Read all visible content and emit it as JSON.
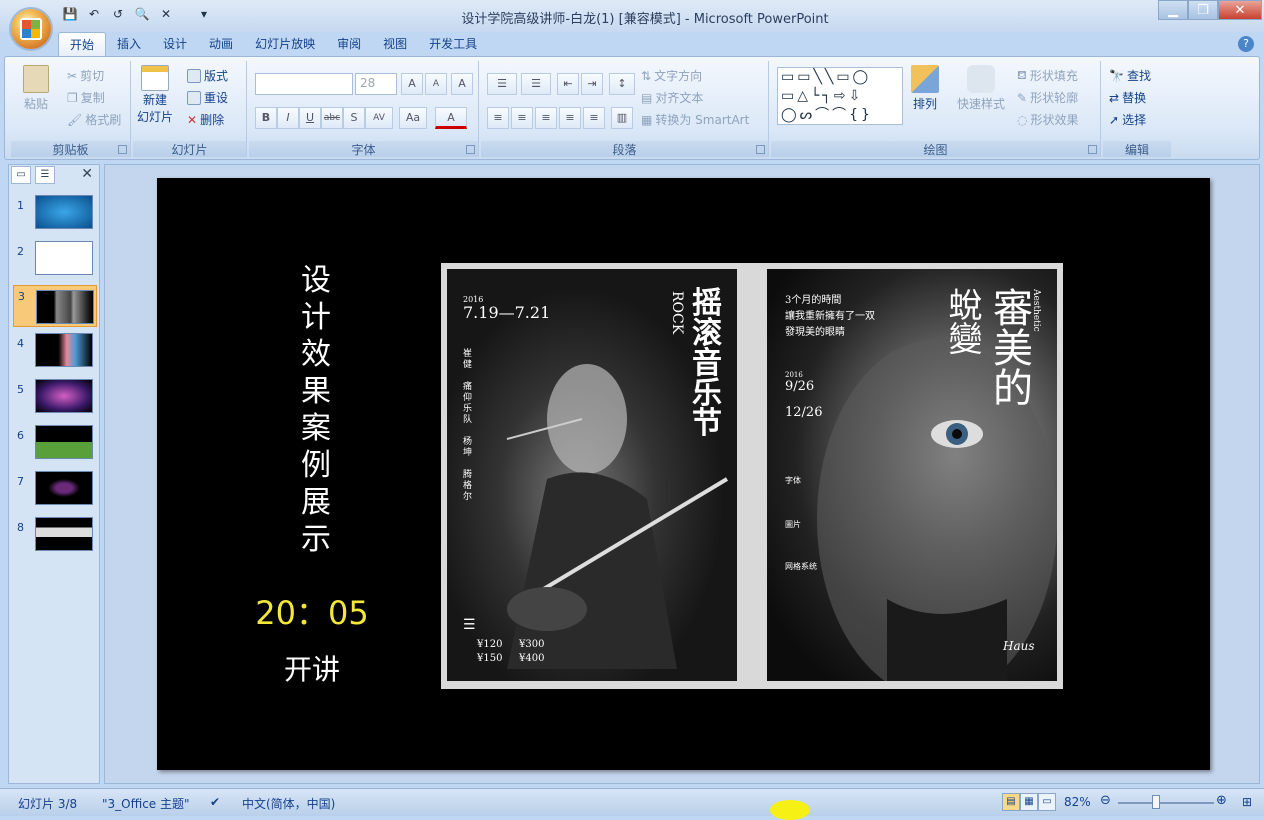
{
  "window": {
    "title": "设计学院高级讲师-白龙(1) [兼容模式] - Microsoft PowerPoint",
    "minimize": "▁",
    "restore": "❐",
    "close": "✕"
  },
  "qat": {
    "save": "💾",
    "undo": "↶",
    "redo": "↺",
    "preview": "🔍",
    "extra": "✕",
    "more": "▾"
  },
  "tabs": [
    "开始",
    "插入",
    "设计",
    "动画",
    "幻灯片放映",
    "审阅",
    "视图",
    "开发工具"
  ],
  "help": "?",
  "ribbon": {
    "clipboard": {
      "label": "剪贴板",
      "paste": "粘贴",
      "cut": "剪切",
      "copy": "复制",
      "format_painter": "格式刷"
    },
    "slides": {
      "label": "幻灯片",
      "new_slide_1": "新建",
      "new_slide_2": "幻灯片",
      "layout": "版式",
      "reset": "重设",
      "delete": "删除"
    },
    "font": {
      "label": "字体",
      "font_size": "28",
      "grow": "A",
      "shrink": "A",
      "clear": "A",
      "bold": "B",
      "italic": "I",
      "underline": "U",
      "strike": "abc",
      "shadow": "S",
      "spacing": "AV",
      "case": "Aa",
      "color": "A"
    },
    "paragraph": {
      "label": "段落",
      "text_direction": "文字方向",
      "align_text": "对齐文本",
      "smartart": "转换为 SmartArt"
    },
    "drawing": {
      "label": "绘图",
      "arrange": "排列",
      "quick_styles": "快速样式",
      "shape_fill": "形状填充",
      "shape_outline": "形状轮廓",
      "shape_effects": "形状效果"
    },
    "editing": {
      "label": "编辑",
      "find": "查找",
      "replace": "替换",
      "select": "选择"
    }
  },
  "slide_panel": {
    "thumbs": [
      "1",
      "2",
      "3",
      "4",
      "5",
      "6",
      "7",
      "8"
    ],
    "selected": 3,
    "close": "✕"
  },
  "slide": {
    "title_chars": [
      "设",
      "计",
      "效",
      "果",
      "案",
      "例",
      "展",
      "示"
    ],
    "timer": "20：05",
    "subtitle": "开讲"
  },
  "poster1": {
    "date_year": "2016",
    "date": "7.19—7.21",
    "rock": "ROCK",
    "title_chars": [
      "摇",
      "滚",
      "音",
      "乐",
      "节"
    ],
    "bands": [
      "崔",
      "健",
      "痛",
      "仰",
      "乐",
      "队",
      "杨",
      "坤",
      "腾",
      "格",
      "尔"
    ],
    "price1": "¥120",
    "price2": "¥300",
    "price3": "¥150",
    "price4": "¥400"
  },
  "poster2": {
    "title_a": "審美的",
    "title_b": "蛻變",
    "aesthetic": "Aesthetic",
    "line1": "3个月的時間",
    "line2": "讓我重新擁有了一双",
    "line3": "發現美的眼睛",
    "year": "2016",
    "date1": "9/26",
    "date2": "12/26",
    "s1": "字体",
    "s2": "圖片",
    "s3": "网格系统",
    "signature": "Haus"
  },
  "status": {
    "slide": "幻灯片 3/8",
    "theme": "\"3_Office 主题\"",
    "lang": "中文(简体，中国)",
    "zoom": "82%"
  }
}
